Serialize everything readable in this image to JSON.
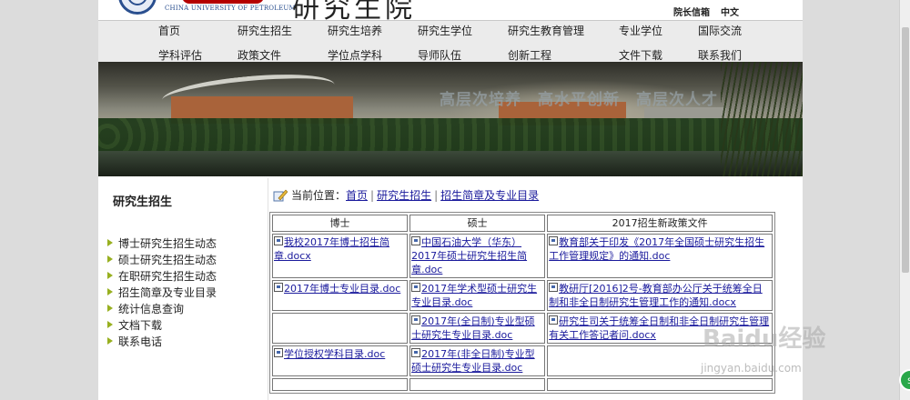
{
  "header": {
    "university_en": "CHINA UNIVERSITY OF PETROLEUM",
    "title": "研究生院",
    "links": [
      "院长信箱",
      "中文"
    ]
  },
  "nav": {
    "row1": [
      "首页",
      "研究生招生",
      "研究生培养",
      "研究生学位",
      "研究生教育管理",
      "专业学位",
      "国际交流"
    ],
    "row2": [
      "学科评估",
      "政策文件",
      "学位点学科",
      "导师队伍",
      "创新工程",
      "文件下载",
      "联系我们"
    ]
  },
  "banner": {
    "slogan": "高层次培养　高水平创新　高层次人才"
  },
  "sidebar": {
    "title": "研究生招生",
    "items": [
      "博士研究生招生动态",
      "硕士研究生招生动态",
      "在职研究生招生动态",
      "招生简章及专业目录",
      "统计信息查询",
      "文档下载",
      "联系电话"
    ]
  },
  "breadcrumb": {
    "label": "当前位置：",
    "items": [
      "首页",
      "研究生招生",
      "招生简章及专业目录"
    ]
  },
  "table": {
    "headers": [
      "博士",
      "硕士",
      "2017招生新政策文件"
    ],
    "rows": [
      [
        "我校2017年博士招生简章.docx",
        "中国石油大学（华东）2017年硕士研究生招生简章.doc",
        "教育部关于印发《2017年全国硕士研究生招生工作管理规定》的通知.doc"
      ],
      [
        "2017年博士专业目录.doc",
        "2017年学术型硕士研究生专业目录.doc",
        "教研厅[2016]2号-教育部办公厅关于统筹全日制和非全日制研究生管理工作的通知.docx"
      ],
      [
        "",
        "2017年(全日制)专业型硕士研究生专业目录.doc",
        "研究生司关于统筹全日制和非全日制研究生管理有关工作答记者问.docx"
      ],
      [
        "学位授权学科目录.doc",
        "2017年(非全日制)专业型硕士研究生专业目录.doc",
        ""
      ],
      [
        "",
        "",
        ""
      ]
    ]
  },
  "watermark": {
    "text": "Baidu经验",
    "url": "jingyan.baidu.com"
  },
  "colors": {
    "link": "#1a1a9c",
    "nav_bg": "#ebebeb",
    "accent_green": "#98b020",
    "brand_blue": "#2a4f8f",
    "brand_red": "#b40000"
  }
}
